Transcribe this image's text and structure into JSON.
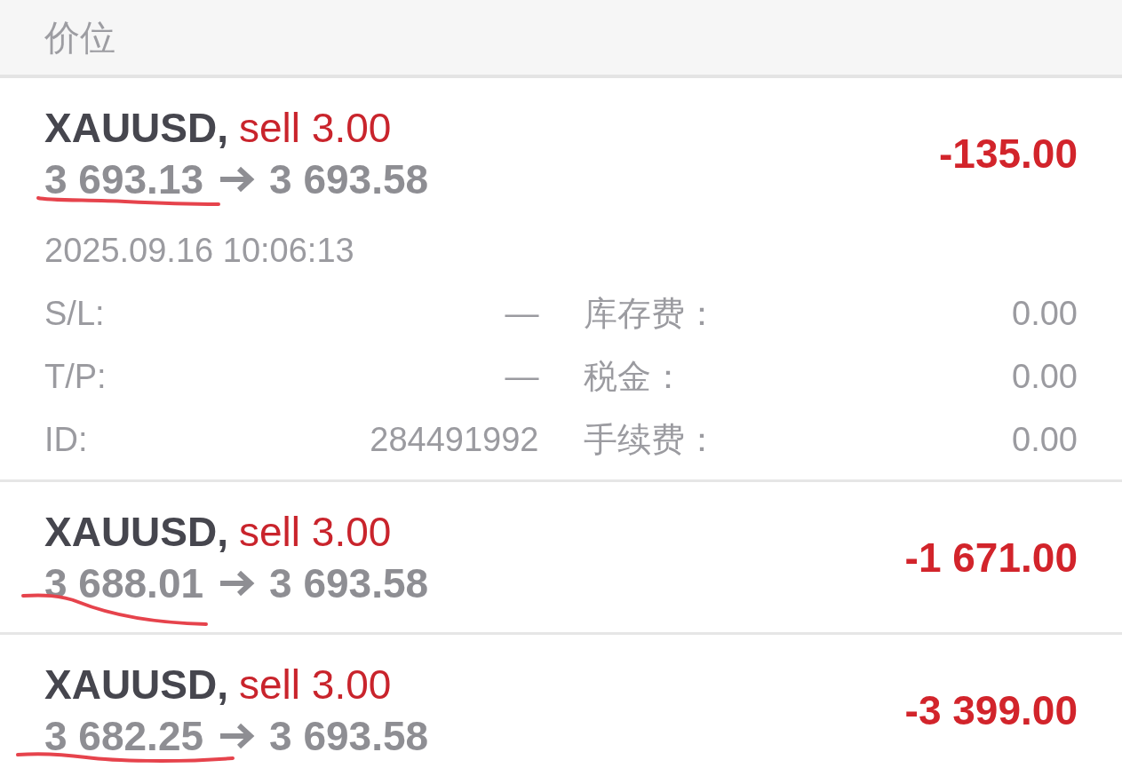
{
  "header": {
    "title": "价位"
  },
  "positions": [
    {
      "symbol": "XAUUSD,",
      "order": "sell 3.00",
      "open_price": "3 693.13",
      "current_price": "3 693.58",
      "profit": "-135.00",
      "open_price_underlined": true,
      "expanded": true,
      "open_time": "2025.09.16 10:06:13",
      "details": [
        {
          "label": "S/L:",
          "value": "—",
          "fee_label": "库存费：",
          "fee_value": "0.00"
        },
        {
          "label": "T/P:",
          "value": "—",
          "fee_label": "税金：",
          "fee_value": "0.00"
        },
        {
          "label": "ID:",
          "value": "284491992",
          "fee_label": "手续费：",
          "fee_value": "0.00"
        }
      ]
    },
    {
      "symbol": "XAUUSD,",
      "order": "sell 3.00",
      "open_price": "3 688.01",
      "current_price": "3 693.58",
      "profit": "-1 671.00",
      "open_price_underlined": true,
      "expanded": false
    },
    {
      "symbol": "XAUUSD,",
      "order": "sell 3.00",
      "open_price": "3 682.25",
      "current_price": "3 693.58",
      "profit": "-3 399.00",
      "open_price_underlined": true,
      "expanded": false
    }
  ]
}
